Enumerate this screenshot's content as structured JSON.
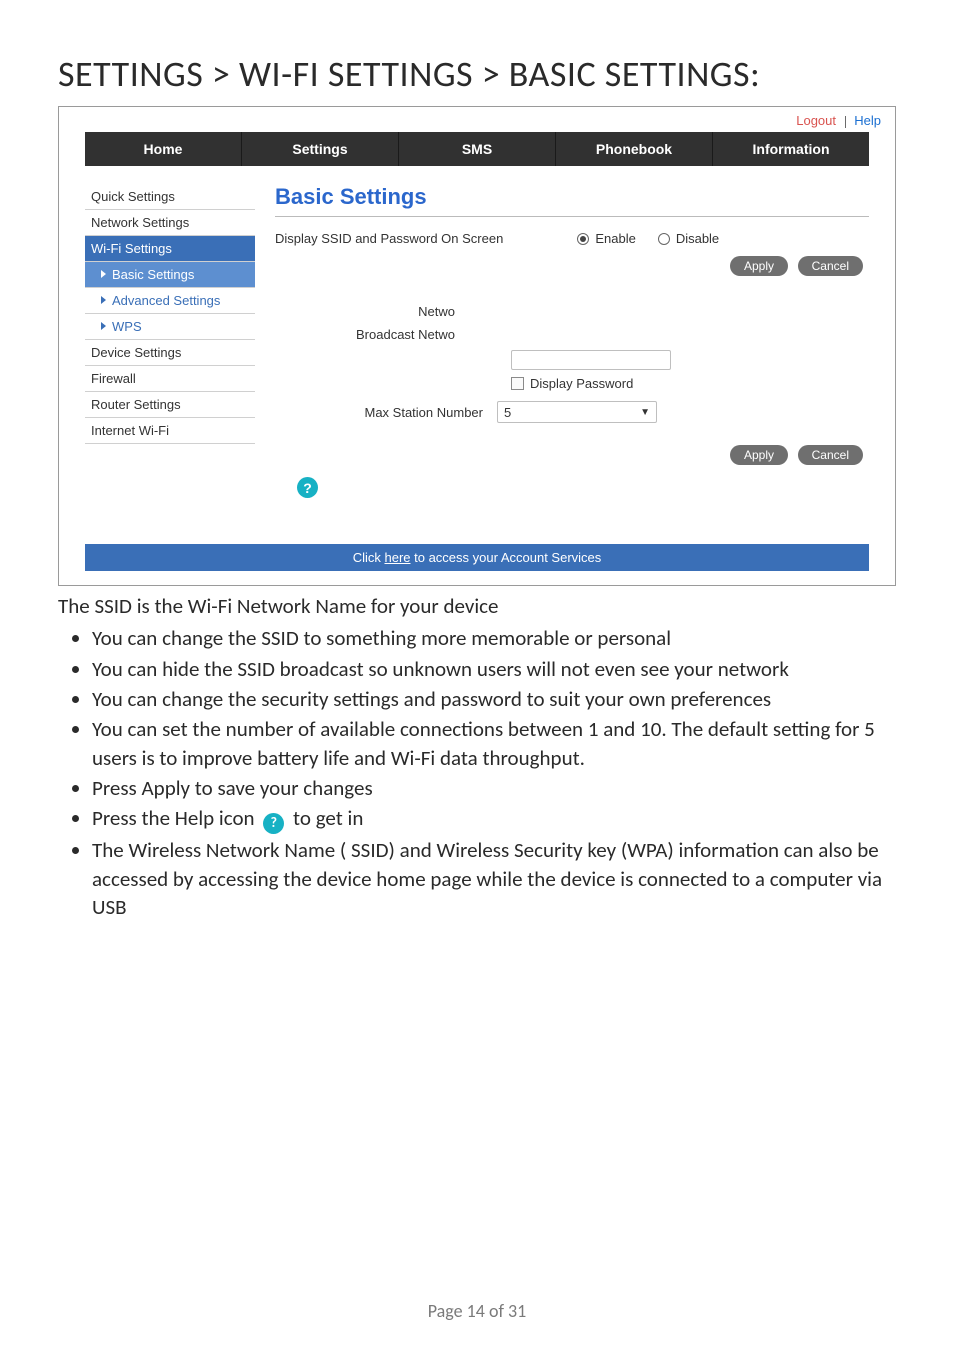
{
  "heading": "SETTINGS > WI-FI SETTINGS > BASIC SETTINGS:",
  "top_links": {
    "logout": "Logout",
    "help": "Help"
  },
  "tabs": {
    "home": "Home",
    "settings": "Settings",
    "sms": "SMS",
    "phonebook": "Phonebook",
    "information": "Information"
  },
  "sidebar": {
    "quick": "Quick Settings",
    "network": "Network Settings",
    "wifi": "Wi-Fi Settings",
    "basic": "Basic Settings",
    "advanced": "Advanced Settings",
    "wps": "WPS",
    "device": "Device Settings",
    "firewall": "Firewall",
    "router": "Router Settings",
    "internet_wifi": "Internet Wi-Fi"
  },
  "panel": {
    "title": "Basic Settings",
    "display_label": "Display SSID and Password On Screen",
    "enable": "Enable",
    "disable": "Disable",
    "apply": "Apply",
    "cancel": "Cancel",
    "netw_trunc": "Netwo",
    "broadcast_trunc": "Broadcast Netwo",
    "display_password": "Display Password",
    "max_station": "Max Station Number",
    "max_station_value": "5"
  },
  "footer": {
    "prefix": "Click ",
    "here": "here",
    "suffix": " to access your Account Services"
  },
  "explain": {
    "intro": "The SSID is the Wi-Fi Network Name for your device",
    "li1": "You can change the SSID to something more memorable or personal",
    "li2": "You can hide the SSID broadcast so unknown users will not even see your network",
    "li3": "You can change the security settings and password to suit your own preferences",
    "li4": "You can set the number of available connections between 1 and 10. The default setting for 5 users is to improve battery life and Wi-Fi data throughput.",
    "li5": "Press Apply to save your changes",
    "li6a": "Press the Help icon ",
    "li6b": " to get in",
    "li7": "The Wireless Network Name ( SSID) and Wireless Security key (WPA) information can also be accessed by accessing the device home page while the device is connected to a computer via USB"
  },
  "page_number": "Page 14 of 31"
}
